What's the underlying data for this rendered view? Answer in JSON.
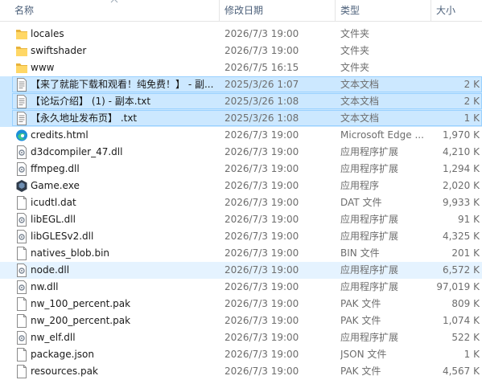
{
  "columns": {
    "name": "名称",
    "date": "修改日期",
    "type": "类型",
    "size": "大小"
  },
  "rows": [
    {
      "icon": "folder-icon",
      "name": "locales",
      "date": "2026/7/3 19:00",
      "type": "文件夹",
      "size": ""
    },
    {
      "icon": "folder-icon",
      "name": "swiftshader",
      "date": "2026/7/3 19:00",
      "type": "文件夹",
      "size": ""
    },
    {
      "icon": "folder-icon",
      "name": "www",
      "date": "2026/7/5 16:15",
      "type": "文件夹",
      "size": ""
    },
    {
      "icon": "text-file-icon",
      "name": "【来了就能下载和观看！纯免费！】 - 副...",
      "date": "2025/3/26 1:07",
      "type": "文本文档",
      "size": "2 K",
      "state": "selected"
    },
    {
      "icon": "text-file-icon",
      "name": "【论坛介绍】 (1) - 副本.txt",
      "date": "2025/3/26 1:08",
      "type": "文本文档",
      "size": "2 K",
      "state": "selected"
    },
    {
      "icon": "text-file-icon",
      "name": "【永久地址发布页】 .txt",
      "date": "2025/3/26 1:08",
      "type": "文本文档",
      "size": "1 K",
      "state": "selected"
    },
    {
      "icon": "edge-icon",
      "name": "credits.html",
      "date": "2026/7/3 19:00",
      "type": "Microsoft Edge ...",
      "size": "1,970 K"
    },
    {
      "icon": "dll-file-icon",
      "name": "d3dcompiler_47.dll",
      "date": "2026/7/3 19:00",
      "type": "应用程序扩展",
      "size": "4,210 K"
    },
    {
      "icon": "dll-file-icon",
      "name": "ffmpeg.dll",
      "date": "2026/7/3 19:00",
      "type": "应用程序扩展",
      "size": "1,294 K"
    },
    {
      "icon": "game-exe-icon",
      "name": "Game.exe",
      "date": "2026/7/3 19:00",
      "type": "应用程序",
      "size": "2,020 K"
    },
    {
      "icon": "blank-file-icon",
      "name": "icudtl.dat",
      "date": "2026/7/3 19:00",
      "type": "DAT 文件",
      "size": "9,933 K"
    },
    {
      "icon": "dll-file-icon",
      "name": "libEGL.dll",
      "date": "2026/7/3 19:00",
      "type": "应用程序扩展",
      "size": "91 K"
    },
    {
      "icon": "dll-file-icon",
      "name": "libGLESv2.dll",
      "date": "2026/7/3 19:00",
      "type": "应用程序扩展",
      "size": "4,325 K"
    },
    {
      "icon": "blank-file-icon",
      "name": "natives_blob.bin",
      "date": "2026/7/3 19:00",
      "type": "BIN 文件",
      "size": "201 K"
    },
    {
      "icon": "dll-file-icon",
      "name": "node.dll",
      "date": "2026/7/3 19:00",
      "type": "应用程序扩展",
      "size": "6,572 K",
      "state": "hover"
    },
    {
      "icon": "dll-file-icon",
      "name": "nw.dll",
      "date": "2026/7/3 19:00",
      "type": "应用程序扩展",
      "size": "97,019 K"
    },
    {
      "icon": "blank-file-icon",
      "name": "nw_100_percent.pak",
      "date": "2026/7/3 19:00",
      "type": "PAK 文件",
      "size": "809 K"
    },
    {
      "icon": "blank-file-icon",
      "name": "nw_200_percent.pak",
      "date": "2026/7/3 19:00",
      "type": "PAK 文件",
      "size": "1,074 K"
    },
    {
      "icon": "dll-file-icon",
      "name": "nw_elf.dll",
      "date": "2026/7/3 19:00",
      "type": "应用程序扩展",
      "size": "522 K"
    },
    {
      "icon": "blank-file-icon",
      "name": "package.json",
      "date": "2026/7/3 19:00",
      "type": "JSON 文件",
      "size": "1 K"
    },
    {
      "icon": "blank-file-icon",
      "name": "resources.pak",
      "date": "2026/7/3 19:00",
      "type": "PAK 文件",
      "size": "4,567 K"
    }
  ],
  "colors": {
    "selection_bg": "#cce8ff",
    "selection_border": "#99d1ff",
    "hover_bg": "#e5f3ff",
    "folder": "#ffd766"
  }
}
